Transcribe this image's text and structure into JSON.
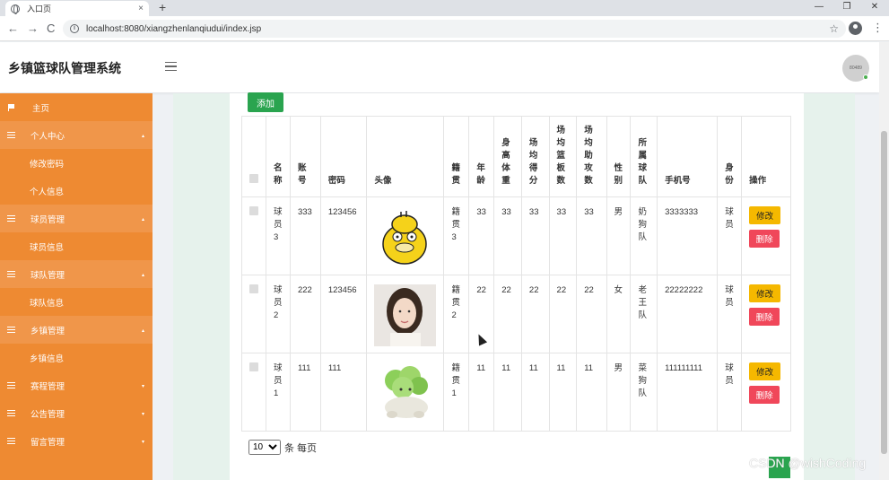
{
  "browser": {
    "tab_title": "入口页",
    "tab_close": "×",
    "new_tab": "+",
    "url": "localhost:8080/xiangzhenlanqiudui/index.jsp",
    "back": "←",
    "forward": "→",
    "reload": "C",
    "star": "☆",
    "kebab": "⋮",
    "minimize": "—",
    "restore": "❐",
    "close": "✕"
  },
  "header": {
    "title": "乡镇篮球队管理系统",
    "avatar_text": "80489"
  },
  "sidebar": {
    "items": [
      {
        "label": "主页"
      },
      {
        "label": "个人中心"
      },
      {
        "label": "修改密码"
      },
      {
        "label": "个人信息"
      },
      {
        "label": "球员管理"
      },
      {
        "label": "球员信息"
      },
      {
        "label": "球队管理"
      },
      {
        "label": "球队信息"
      },
      {
        "label": "乡镇管理"
      },
      {
        "label": "乡镇信息"
      },
      {
        "label": "赛程管理"
      },
      {
        "label": "公告管理"
      },
      {
        "label": "留言管理"
      }
    ],
    "caret_up": "▴",
    "caret_down": "▾"
  },
  "toolbar": {
    "add_label": "添加"
  },
  "table": {
    "columns": [
      "名称",
      "账号",
      "密码",
      "头像",
      "籍贯",
      "年龄",
      "身高体重",
      "场均得分",
      "场均篮板数",
      "场均助攻数",
      "性别",
      "所属球队",
      "手机号",
      "身份",
      "操作"
    ],
    "rows": [
      {
        "name": "球员3",
        "account": "333",
        "password": "123456",
        "avatar": "duck-avatar",
        "hometown": "籍贯3",
        "age": "33",
        "height_weight": "33",
        "points": "33",
        "rebounds": "33",
        "assists": "33",
        "gender": "男",
        "team": "奶狗队",
        "phone": "3333333",
        "role": "球员"
      },
      {
        "name": "球员2",
        "account": "222",
        "password": "123456",
        "avatar": "woman-avatar",
        "hometown": "籍贯2",
        "age": "22",
        "height_weight": "22",
        "points": "22",
        "rebounds": "22",
        "assists": "22",
        "gender": "女",
        "team": "老王队",
        "phone": "22222222",
        "role": "球员"
      },
      {
        "name": "球员1",
        "account": "111",
        "password": "111",
        "avatar": "cabbage-dog-avatar",
        "hometown": "籍贯1",
        "age": "11",
        "height_weight": "11",
        "points": "11",
        "rebounds": "11",
        "assists": "11",
        "gender": "男",
        "team": "菜狗队",
        "phone": "111111111",
        "role": "球员"
      }
    ],
    "edit_label": "修改",
    "delete_label": "删除"
  },
  "pager": {
    "page_size": "10",
    "suffix": "条 每页"
  },
  "watermark": "CSDN @wishCoding",
  "colors": {
    "sidebar": "#ee8a32",
    "add": "#2aa44f",
    "edit": "#f5b800",
    "delete": "#f0475a"
  }
}
